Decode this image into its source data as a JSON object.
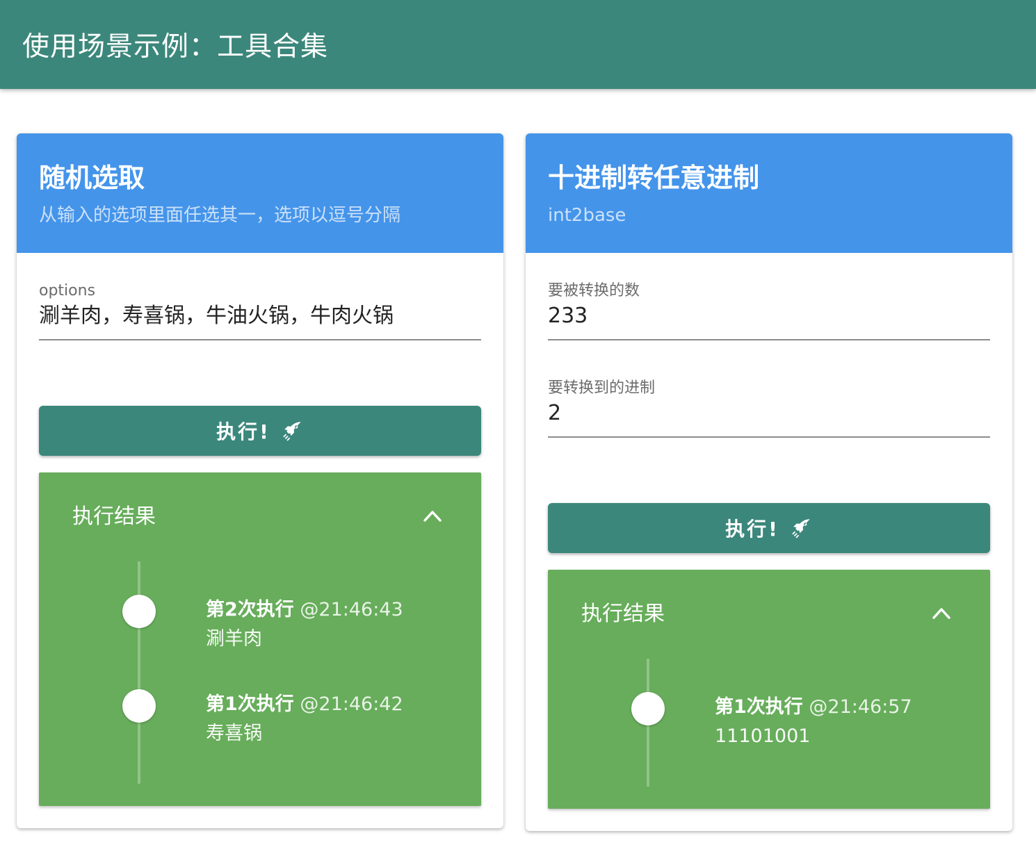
{
  "appbar": {
    "title": "使用场景示例：工具合集"
  },
  "cards": [
    {
      "title": "随机选取",
      "subtitle": "从输入的选项里面任选其一，选项以逗号分隔",
      "fields": [
        {
          "label": "options",
          "value": "涮羊肉，寿喜锅，牛油火锅，牛肉火锅"
        }
      ],
      "run_button": {
        "label": "执行!",
        "icon": "rocket-icon"
      },
      "results": {
        "title": "执行结果",
        "toggle_icon": "chevron-up-icon",
        "entries": [
          {
            "run": "第2次执行",
            "time": "@21:46:43",
            "output": "涮羊肉"
          },
          {
            "run": "第1次执行",
            "time": "@21:46:42",
            "output": "寿喜锅"
          }
        ]
      }
    },
    {
      "title": "十进制转任意进制",
      "subtitle": "int2base",
      "fields": [
        {
          "label": "要被转换的数",
          "value": "233"
        },
        {
          "label": "要转换到的进制",
          "value": "2"
        }
      ],
      "run_button": {
        "label": "执行!",
        "icon": "rocket-icon"
      },
      "results": {
        "title": "执行结果",
        "toggle_icon": "chevron-up-icon",
        "entries": [
          {
            "run": "第1次执行",
            "time": "@21:46:57",
            "output": "11101001"
          }
        ]
      }
    }
  ],
  "colors": {
    "appbar": "#3b877b",
    "card_header": "#4494ea",
    "button": "#3b877b",
    "result_panel": "#67ad5b"
  }
}
